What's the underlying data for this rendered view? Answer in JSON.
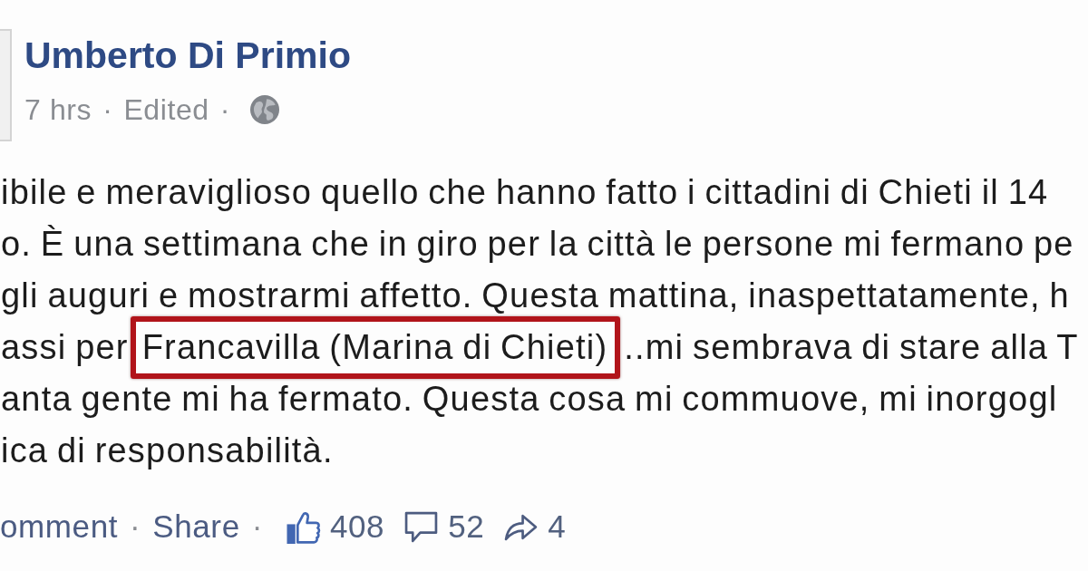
{
  "author": {
    "name": "Umberto Di Primio",
    "meta": [
      {
        "kind": "text",
        "text": "7 hrs"
      },
      {
        "kind": "separator",
        "text": "·"
      },
      {
        "kind": "text",
        "text": "Edited"
      },
      {
        "kind": "separator",
        "text": "·"
      },
      {
        "kind": "globe"
      }
    ]
  },
  "body": {
    "lines": [
      {
        "segments": [
          {
            "text": "ibile e meraviglioso quello che hanno fatto i cittadini di Chieti il 14",
            "highlighted": false
          }
        ]
      },
      {
        "segments": [
          {
            "text": "o. È una settimana che in giro per la città le persone mi fermano pe",
            "highlighted": false
          }
        ]
      },
      {
        "segments": [
          {
            "text": "gli auguri e mostrarmi affetto. Questa mattina, inaspettatamente, h",
            "highlighted": false
          }
        ]
      },
      {
        "segments": [
          {
            "text": "assi per",
            "highlighted": false
          },
          {
            "text": "Francavilla (Marina di Chieti)",
            "highlighted": true
          },
          {
            "text": "..mi sembrava di stare alla T",
            "highlighted": false
          }
        ]
      },
      {
        "segments": [
          {
            "text": "anta gente mi ha fermato. Questa cosa mi commuove, mi inorgogl",
            "highlighted": false
          }
        ]
      },
      {
        "segments": [
          {
            "text": "ica di responsabilità.",
            "highlighted": false
          }
        ]
      }
    ]
  },
  "actions": [
    {
      "kind": "link",
      "text": "omment"
    },
    {
      "kind": "separator",
      "text": "·"
    },
    {
      "kind": "link",
      "text": "Share"
    },
    {
      "kind": "separator",
      "text": "·"
    },
    {
      "kind": "likes",
      "text": "408"
    },
    {
      "kind": "comments",
      "text": "52"
    },
    {
      "kind": "shares",
      "text": "4"
    }
  ]
}
